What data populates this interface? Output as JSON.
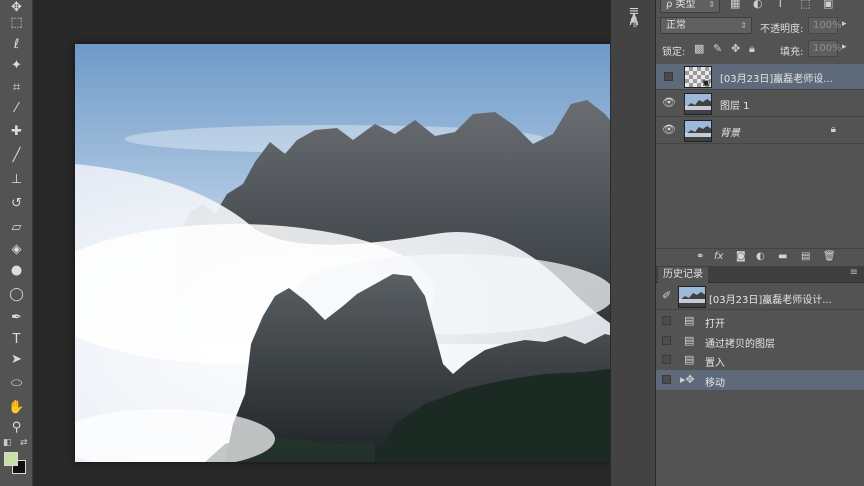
{
  "toolbar": {
    "tools": [
      {
        "name": "move-tool-icon",
        "glyph": "✥"
      },
      {
        "name": "marquee-tool-icon",
        "glyph": "⬚"
      },
      {
        "name": "lasso-tool-icon",
        "glyph": "ℓ"
      },
      {
        "name": "magic-wand-tool-icon",
        "glyph": "✦"
      },
      {
        "name": "crop-tool-icon",
        "glyph": "⌗"
      },
      {
        "name": "eyedropper-tool-icon",
        "glyph": "⁄"
      },
      {
        "name": "healing-brush-tool-icon",
        "glyph": "✚"
      },
      {
        "name": "brush-tool-icon",
        "glyph": "╱"
      },
      {
        "name": "stamp-tool-icon",
        "glyph": "⊥"
      },
      {
        "name": "history-brush-tool-icon",
        "glyph": "↺"
      },
      {
        "name": "eraser-tool-icon",
        "glyph": "▱"
      },
      {
        "name": "paint-bucket-tool-icon",
        "glyph": "◈"
      },
      {
        "name": "blur-tool-icon",
        "glyph": "●"
      },
      {
        "name": "dodge-tool-icon",
        "glyph": "◯"
      },
      {
        "name": "pen-tool-icon",
        "glyph": "✒"
      },
      {
        "name": "type-tool-icon",
        "glyph": "T"
      },
      {
        "name": "path-selection-tool-icon",
        "glyph": "➤"
      },
      {
        "name": "shape-tool-icon",
        "glyph": "⬭"
      },
      {
        "name": "hand-tool-icon",
        "glyph": "✋"
      },
      {
        "name": "zoom-tool-icon",
        "glyph": "⚲"
      }
    ],
    "foreground_color": "#c8e0a8",
    "background_color": "#111111"
  },
  "layers_panel": {
    "filter_label": "ρ 类型",
    "blend_mode": "正常",
    "opacity_label": "不透明度:",
    "opacity_value": "100%",
    "lock_label": "锁定:",
    "fill_label": "填充:",
    "fill_value": "100%",
    "layers": [
      {
        "name": "[03月23日]蠃磊老师设...",
        "visible": false,
        "thumb": "checker",
        "active": true
      },
      {
        "name": "图层 1",
        "visible": true,
        "thumb": "photo",
        "active": false
      },
      {
        "name": "背景",
        "visible": true,
        "thumb": "photo",
        "active": false,
        "locked": true
      }
    ]
  },
  "history_panel": {
    "tab_label": "历史记录",
    "snapshot_label": "[03月23日]蠃磊老师设计...",
    "items": [
      {
        "label": "打开",
        "icon": "document-icon",
        "active": false
      },
      {
        "label": "通过拷贝的图层",
        "icon": "document-icon",
        "active": false
      },
      {
        "label": "置入",
        "icon": "document-icon",
        "active": false
      },
      {
        "label": "移动",
        "icon": "move-icon",
        "active": true
      }
    ]
  }
}
